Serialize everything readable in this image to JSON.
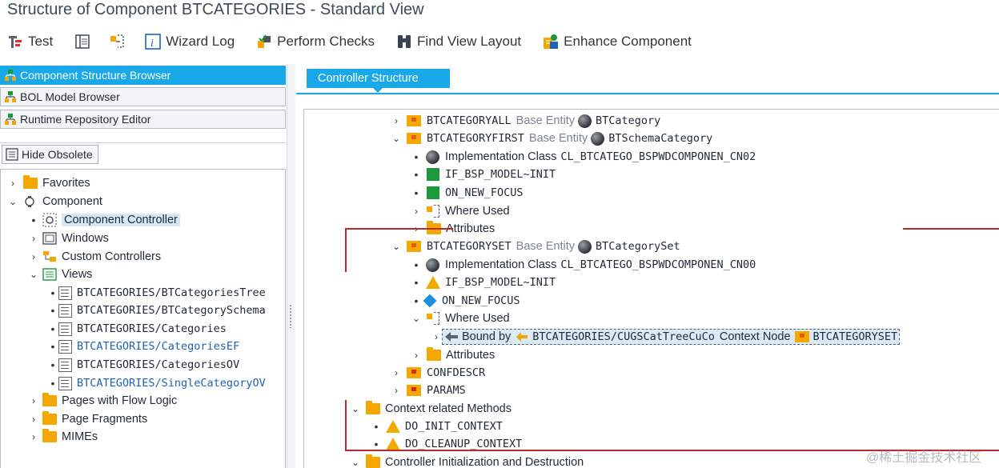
{
  "window": {
    "title": "Structure of Component BTCATEGORIES - Standard View"
  },
  "toolbar": {
    "test": "Test",
    "wizard_log": "Wizard Log",
    "perform_checks": "Perform Checks",
    "find_view_layout": "Find View Layout",
    "enhance_component": "Enhance Component"
  },
  "left_nav": {
    "component_structure_browser": "Component Structure Browser",
    "bol_model_browser": "BOL Model Browser",
    "runtime_repository_editor": "Runtime Repository Editor",
    "hide_obsolete": "Hide Obsolete"
  },
  "left_tree": {
    "favorites": "Favorites",
    "component": "Component",
    "component_controller": "Component Controller",
    "windows": "Windows",
    "custom_controllers": "Custom Controllers",
    "views": "Views",
    "view_items": [
      "BTCATEGORIES/BTCategoriesTree",
      "BTCATEGORIES/BTCategorySchema",
      "BTCATEGORIES/Categories",
      "BTCATEGORIES/CategoriesEF",
      "BTCATEGORIES/CategoriesOV",
      "BTCATEGORIES/SingleCategoryOV"
    ],
    "pages_with_flow_logic": "Pages with Flow Logic",
    "page_fragments": "Page Fragments",
    "mimes": "MIMEs"
  },
  "tab": {
    "controller_structure": "Controller Structure"
  },
  "right_tree": {
    "node_all": "BTCATEGORYALL",
    "base_entity": "Base Entity",
    "btcategory": "BTCategory",
    "node_first": "BTCATEGORYFIRST",
    "btschemacategory": "BTSchemaCategory",
    "implementation_class": "Implementation Class",
    "impl_class_first": "CL_BTCATEGO_BSPWDCOMPONEN_CN02",
    "if_bsp_model_init": "IF_BSP_MODEL~INIT",
    "on_new_focus": "ON_NEW_FOCUS",
    "where_used": "Where Used",
    "attributes": "Attributes",
    "node_set": "BTCATEGORYSET",
    "btcategoryset": "BTCategorySet",
    "impl_class_set": "CL_BTCATEGO_BSPWDCOMPONEN_CN00",
    "bound_by": "Bound by",
    "bound_target": "BTCATEGORIES/CUGSCatTreeCuCo",
    "context_node": "Context Node",
    "bound_node": "BTCATEGORYSET",
    "confdescr": "CONFDESCR",
    "params": "PARAMS",
    "context_related_methods": "Context related Methods",
    "do_init_context": "DO_INIT_CONTEXT",
    "do_cleanup_context": "DO_CLEANUP_CONTEXT",
    "controller_init_destruction": "Controller Initialization and Destruction"
  },
  "watermark": "@稀土掘金技术社区",
  "colors": {
    "accent": "#19a8e8",
    "folder": "#f5a700",
    "annotation_red": "#c0282a"
  }
}
